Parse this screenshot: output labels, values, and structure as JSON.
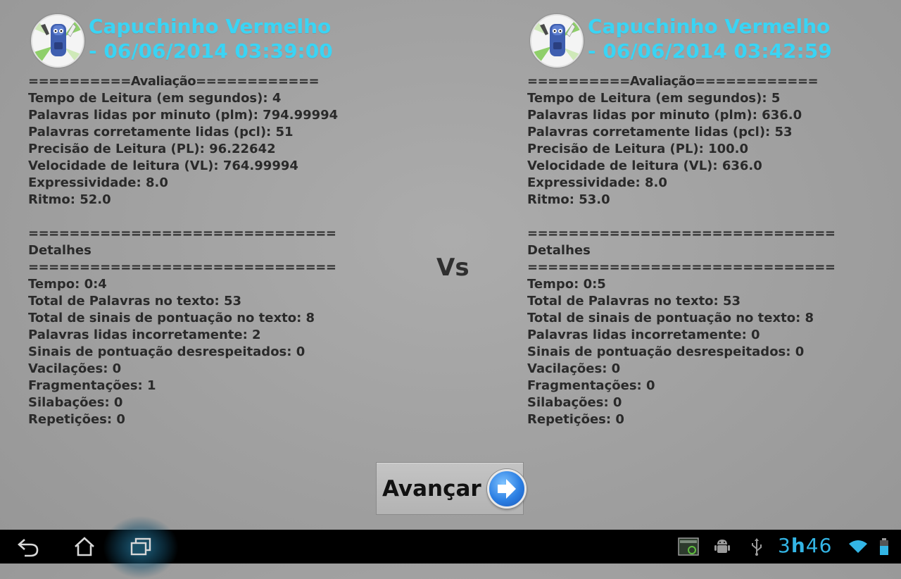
{
  "left": {
    "title": "Capuchinho Vermelho - 06/06/2014 03:39:00",
    "lines": [
      "==========Avaliação============",
      "Tempo de Leitura (em segundos): 4",
      "Palavras lidas por minuto (plm): 794.99994",
      "Palavras corretamente lidas (pcl): 51",
      "Precisão de Leitura (PL): 96.22642",
      "Velocidade de leitura (VL): 764.99994",
      "Expressividade: 8.0",
      "Ritmo: 52.0",
      "",
      "==============================",
      "Detalhes",
      "==============================",
      "Tempo: 0:4",
      "Total de Palavras no texto: 53",
      "Total de sinais de pontuação no texto: 8",
      "Palavras lidas incorretamente: 2",
      "Sinais de pontuação desrespeitados: 0",
      "Vacilações: 0",
      "Fragmentações: 1",
      "Silabações: 0",
      "Repetições: 0"
    ]
  },
  "right": {
    "title": "Capuchinho Vermelho - 06/06/2014 03:42:59",
    "lines": [
      "==========Avaliação============",
      "Tempo de Leitura (em segundos): 5",
      "Palavras lidas por minuto (plm): 636.0",
      "Palavras corretamente lidas (pcl): 53",
      "Precisão de Leitura (PL): 100.0",
      "Velocidade de leitura (VL): 636.0",
      "Expressividade: 8.0",
      "Ritmo: 53.0",
      "",
      "==============================",
      "Detalhes",
      "==============================",
      "Tempo: 0:5",
      "Total de Palavras no texto: 53",
      "Total de sinais de pontuação no texto: 8",
      "Palavras lidas incorretamente: 0",
      "Sinais de pontuação desrespeitados: 0",
      "Vacilações: 0",
      "Fragmentações: 0",
      "Silabações: 0",
      "Repetições: 0"
    ]
  },
  "vs_label": "Vs",
  "advance_button": {
    "label": "Avançar",
    "icon": "arrow-right-icon"
  },
  "status": {
    "clock_hour": "3",
    "clock_sep": "h",
    "clock_min": "46"
  },
  "colors": {
    "title": "#3ad4f4",
    "clock": "#33b5e5",
    "background": "#a6a6a6"
  }
}
